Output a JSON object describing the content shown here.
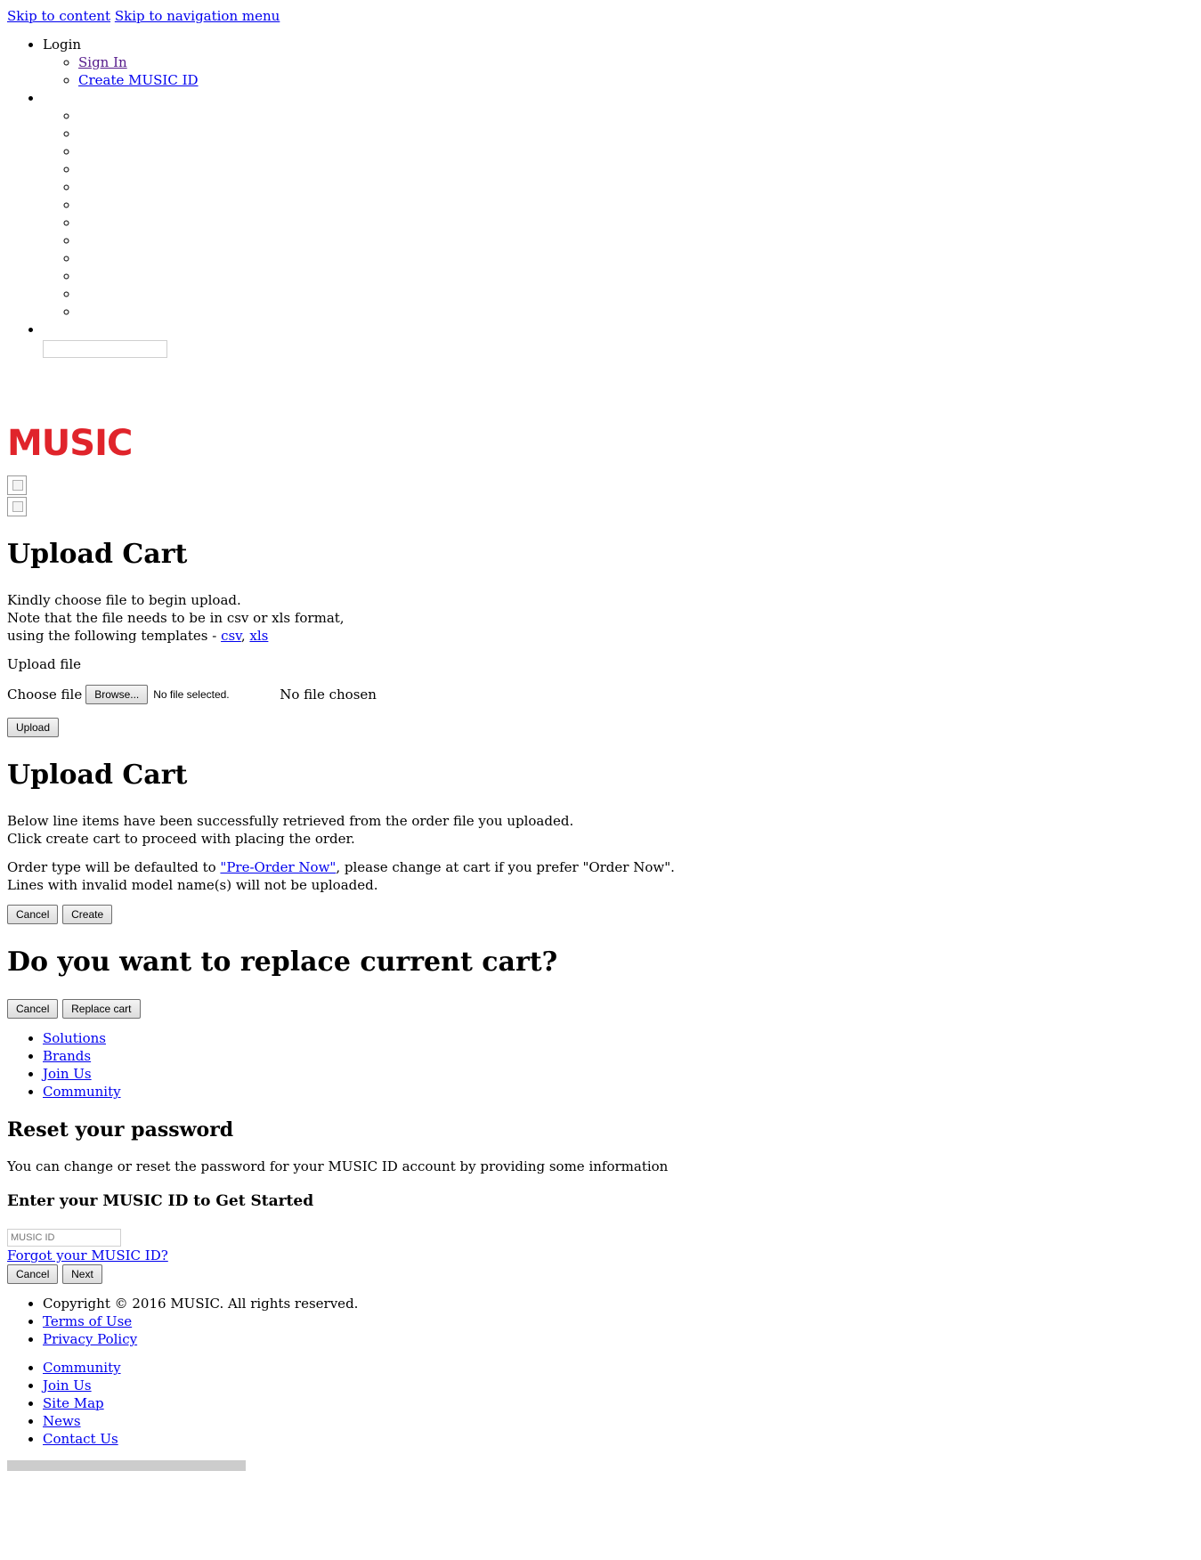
{
  "skip": {
    "content": "Skip to content",
    "nav": "Skip to navigation menu"
  },
  "nav": {
    "login_label": "Login",
    "login_items": [
      "Sign In",
      "Create MUSIC ID"
    ],
    "empty_items_count_placeholder": ""
  },
  "brand": {
    "logo_text": "MUSIC",
    "logo_color": "#e0242b"
  },
  "upload": {
    "heading": "Upload Cart",
    "intro_1": "Kindly choose file to begin upload.",
    "intro_2": "Note that the file needs to be in csv or xls format,",
    "intro_3": "using the following templates - ",
    "template_csv": "csv",
    "template_sep": ", ",
    "template_xls": "xls",
    "upload_file_label": "Upload file",
    "choose_file_label": "Choose file",
    "browse_button": "Browse...",
    "no_file_selected": "No file selected.",
    "no_file_chosen": "No file chosen",
    "upload_button": "Upload"
  },
  "result": {
    "heading": "Upload Cart",
    "line_1": "Below line items have been successfully retrieved from the order file you uploaded.",
    "line_2": "Click create cart to proceed with placing the order.",
    "order_pre": "Order type will be defaulted to ",
    "order_link": "\"Pre-Order Now\"",
    "order_post": ", please change at cart if you prefer \"Order Now\".",
    "invalid_note": "Lines with invalid model name(s) will not be uploaded.",
    "cancel_button": "Cancel",
    "create_button": "Create"
  },
  "replace": {
    "heading": "Do you want to replace current cart?",
    "cancel_button": "Cancel",
    "replace_button": "Replace cart"
  },
  "main_links": [
    "Solutions",
    "Brands",
    "Join Us",
    "Community"
  ],
  "reset": {
    "heading": "Reset your password",
    "desc": "You can change or reset the password for your MUSIC ID account by providing some information",
    "subheading": "Enter your MUSIC ID to Get Started",
    "input_placeholder": "MUSIC ID",
    "forgot_link": "Forgot your MUSIC ID?",
    "cancel_button": "Cancel",
    "next_button": "Next"
  },
  "legal": {
    "copyright": "Copyright © 2016 MUSIC. All rights reserved.",
    "terms": "Terms of Use",
    "privacy": "Privacy Policy"
  },
  "footer_links": [
    "Community",
    "Join Us",
    "Site Map",
    "News",
    "Contact Us"
  ]
}
